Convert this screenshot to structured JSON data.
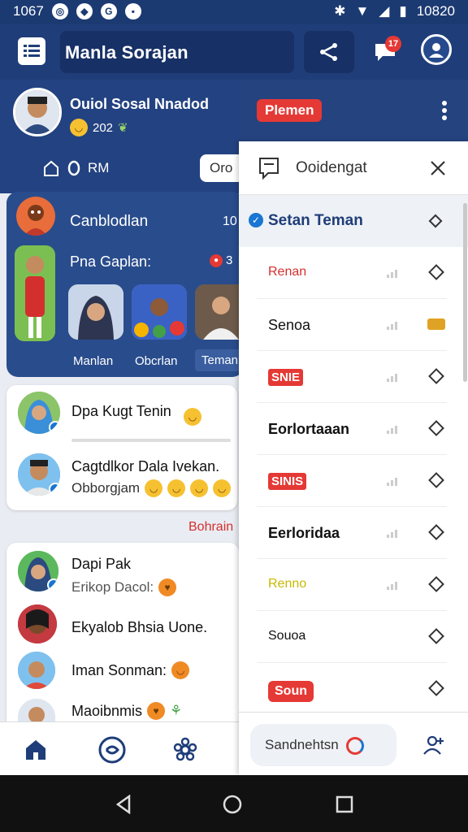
{
  "status_bar": {
    "time_left": "1067",
    "time_right": "10820"
  },
  "app_bar": {
    "title": "Manla Sorajan",
    "chat_badge": "17"
  },
  "profile": {
    "name": "Ouiol Sosal Nnadod",
    "sub": "202"
  },
  "home_tab": {
    "label": "RM"
  },
  "search_chip": {
    "label": "Oro"
  },
  "group_card": {
    "title": "Canblodlan",
    "count": "10",
    "subtitle": "Pna Gaplan:",
    "sub_count": "3",
    "stories": [
      "Manlan",
      "Obcrlan",
      "Teman"
    ]
  },
  "chat_card": {
    "rows": [
      {
        "name": "Dpa Kugt Tenin",
        "sub": ""
      },
      {
        "name": "Cagtdlkor Dala Ivekan.",
        "sub": "Obborgjam"
      }
    ]
  },
  "section_label": "Bohrain",
  "list_card": {
    "rows": [
      {
        "name": "Dapi Pak",
        "sub": "Erikop Dacol:"
      },
      {
        "name": "Ekyalob Bhsia Uone."
      },
      {
        "name": "Iman Sonman:"
      },
      {
        "name": "Maoibnmis"
      }
    ]
  },
  "panel": {
    "tag": "Plemen",
    "title": "Ooidengat",
    "selected": "Setan Teman",
    "friends": [
      {
        "label": "Renan",
        "style": "red"
      },
      {
        "label": "Senoa",
        "style": "plain"
      },
      {
        "label": "SNIE",
        "style": "tag"
      },
      {
        "label": "Eorlortaaan",
        "style": "bold"
      },
      {
        "label": "SINIS",
        "style": "tag"
      },
      {
        "label": "Eerloridaa",
        "style": "bold"
      },
      {
        "label": "Renno",
        "style": "yellow"
      },
      {
        "label": "Souoa",
        "style": "plain"
      },
      {
        "label": "Soun",
        "style": "tag"
      }
    ],
    "search_label": "Sandnehtsn"
  },
  "colors": {
    "primary": "#1f3d78",
    "accent": "#e53935"
  }
}
